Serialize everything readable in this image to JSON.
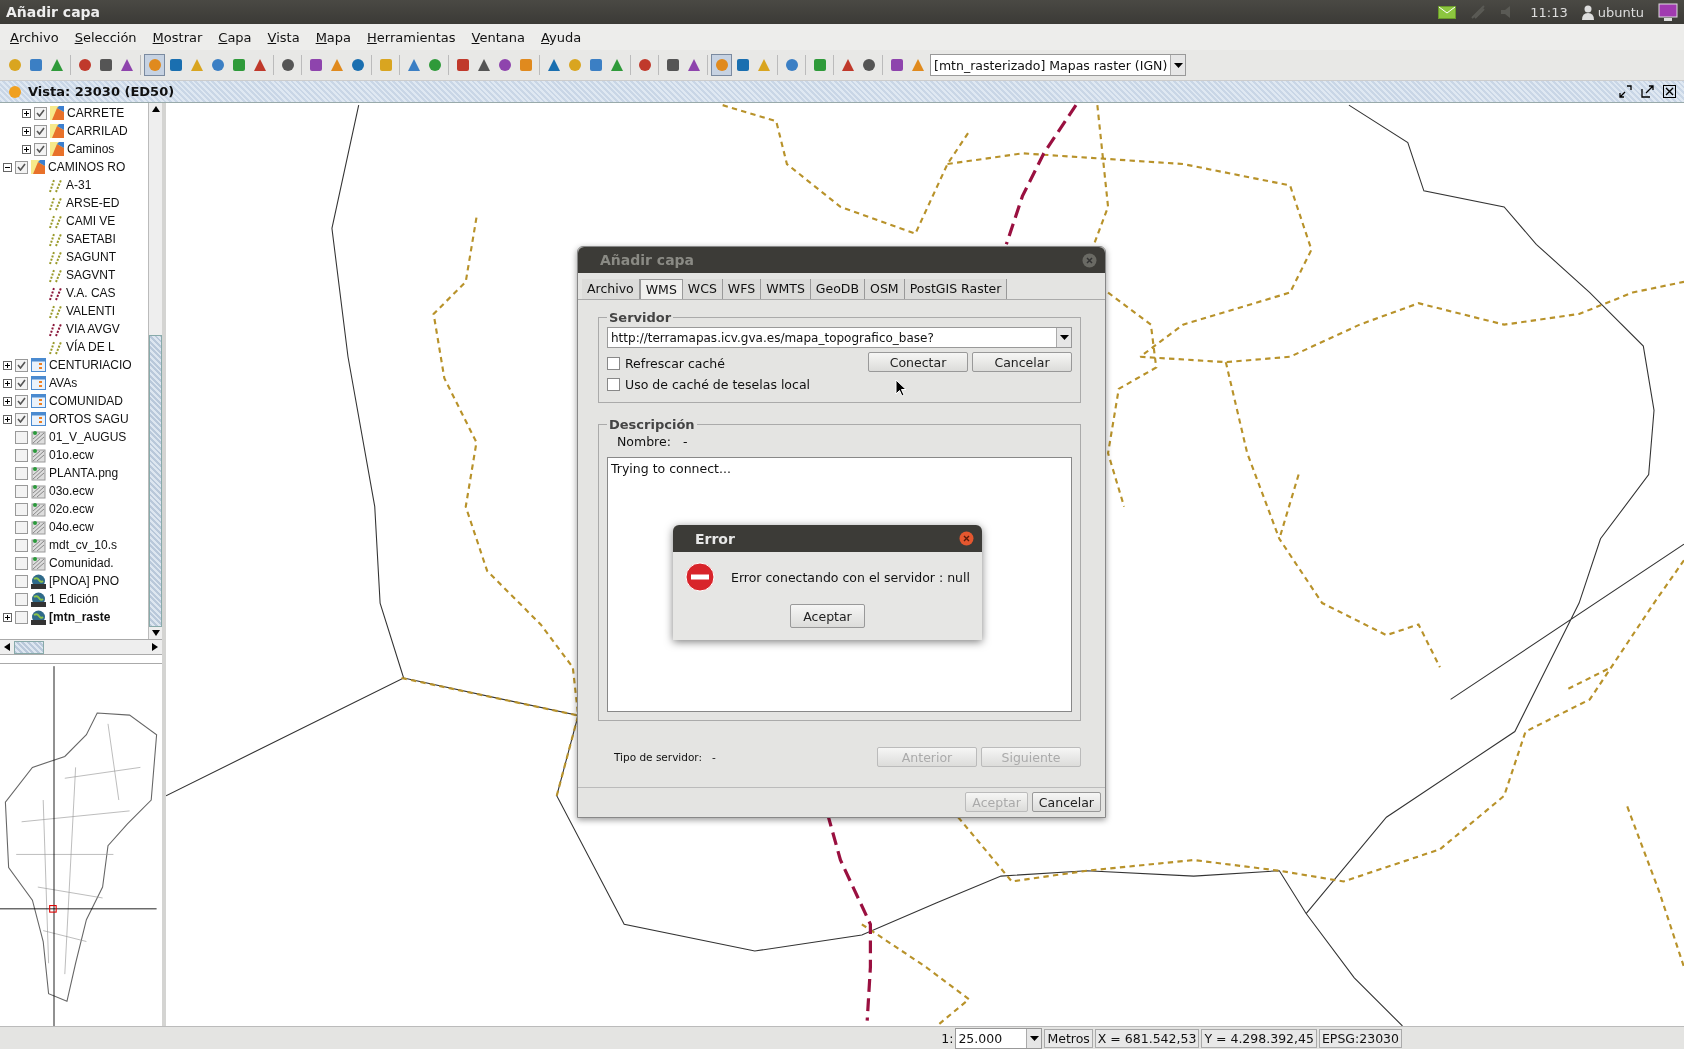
{
  "top_panel": {
    "title": "Añadir capa",
    "clock": "11:13",
    "user": "ubuntu"
  },
  "menu": [
    "Archivo",
    "Selección",
    "Mostrar",
    "Capa",
    "Vista",
    "Mapa",
    "Herramientas",
    "Ventana",
    "Ayuda"
  ],
  "toolbar": {
    "buttons": [
      {
        "selected": false
      },
      {
        "selected": false
      },
      {
        "selected": false
      },
      {
        "selected": false
      },
      {
        "selected": false
      },
      {
        "selected": false
      },
      {
        "selected": true
      },
      {
        "selected": false
      },
      {
        "selected": false
      },
      {
        "selected": false
      },
      {
        "selected": false
      },
      {
        "selected": false
      },
      {
        "selected": false
      },
      {
        "selected": false
      },
      {
        "selected": false
      },
      {
        "selected": false
      },
      {
        "selected": false
      },
      {
        "selected": false
      },
      {
        "selected": false
      },
      {
        "selected": false
      },
      {
        "selected": false
      },
      {
        "selected": false
      },
      {
        "selected": false
      },
      {
        "selected": false
      },
      {
        "selected": false
      },
      {
        "selected": false
      },
      {
        "selected": false
      },
      {
        "selected": false
      },
      {
        "selected": false
      },
      {
        "selected": false
      },
      {
        "selected": true
      },
      {
        "selected": false
      },
      {
        "selected": false
      },
      {
        "selected": false
      },
      {
        "selected": false
      },
      {
        "selected": false
      },
      {
        "selected": false
      },
      {
        "selected": false
      },
      {
        "selected": false
      }
    ],
    "layer_combo": "[mtn_rasterizado] Mapas raster (IGN)"
  },
  "view": {
    "title": "Vista: 23030 (ED50)"
  },
  "tree": {
    "continued_children": [
      {
        "label": "CARRETE",
        "kind": "vector",
        "expanded": false,
        "checked": true,
        "active": false
      },
      {
        "label": "CARRILAD",
        "kind": "vector",
        "expanded": false,
        "checked": true,
        "active": false
      },
      {
        "label": "Caminos",
        "kind": "vector",
        "expanded": false,
        "checked": true,
        "active": false
      }
    ],
    "items": [
      {
        "label": "CAMINOS RO",
        "kind": "vector",
        "expanded": true,
        "checked": true,
        "active": false,
        "children": [
          {
            "label": "A-31",
            "kind": "line"
          },
          {
            "label": "ARSE-ED",
            "kind": "line"
          },
          {
            "label": "CAMI VE",
            "kind": "line"
          },
          {
            "label": "SAETABI",
            "kind": "line"
          },
          {
            "label": "SAGUNT",
            "kind": "line"
          },
          {
            "label": "SAGVNT",
            "kind": "line"
          },
          {
            "label": "V.A. CAS",
            "kind": "line-red"
          },
          {
            "label": "VALENTI",
            "kind": "line"
          },
          {
            "label": "VIA AVGV",
            "kind": "line-red"
          },
          {
            "label": "VÍA DE L",
            "kind": "line"
          }
        ]
      },
      {
        "label": "CENTURIACIO",
        "kind": "group",
        "expanded": false,
        "checked": true,
        "active": false
      },
      {
        "label": "AVAs",
        "kind": "group",
        "expanded": false,
        "checked": true,
        "active": false
      },
      {
        "label": "COMUNIDAD",
        "kind": "group",
        "expanded": false,
        "checked": true,
        "active": false
      },
      {
        "label": "ORTOS SAGU",
        "kind": "group",
        "expanded": false,
        "checked": true,
        "active": false
      },
      {
        "label": "01_V_AUGUS",
        "kind": "raster",
        "checked": false,
        "active": false
      },
      {
        "label": "01o.ecw",
        "kind": "raster",
        "checked": false,
        "active": false
      },
      {
        "label": "PLANTA.png",
        "kind": "raster",
        "checked": false,
        "active": false
      },
      {
        "label": "03o.ecw",
        "kind": "raster",
        "checked": false,
        "active": false
      },
      {
        "label": "02o.ecw",
        "kind": "raster",
        "checked": false,
        "active": false
      },
      {
        "label": "04o.ecw",
        "kind": "raster",
        "checked": false,
        "active": false
      },
      {
        "label": "mdt_cv_10.s",
        "kind": "raster",
        "checked": false,
        "active": false
      },
      {
        "label": "Comunidad.",
        "kind": "raster",
        "checked": false,
        "active": false
      },
      {
        "label": "[PNOA] PNO",
        "kind": "wms",
        "checked": false,
        "active": false
      },
      {
        "label": "1 Edición",
        "kind": "wms",
        "checked": false,
        "active": false
      },
      {
        "label": "[mtn_raste",
        "kind": "wms",
        "expanded": false,
        "checked": false,
        "active": true
      }
    ]
  },
  "dialog": {
    "title": "Añadir capa",
    "tabs": [
      {
        "label": "Archivo",
        "selected": false
      },
      {
        "label": "WMS",
        "selected": true
      },
      {
        "label": "WCS",
        "selected": false
      },
      {
        "label": "WFS",
        "selected": false
      },
      {
        "label": "WMTS",
        "selected": false
      },
      {
        "label": "GeoDB",
        "selected": false
      },
      {
        "label": "OSM",
        "selected": false
      },
      {
        "label": "PostGIS Raster",
        "selected": false
      }
    ],
    "server": {
      "legend": "Servidor",
      "url": "http://terramapas.icv.gva.es/mapa_topografico_base?",
      "connect": "Conectar",
      "cancel": "Cancelar",
      "options": [
        {
          "label": "Refrescar caché",
          "checked": false
        },
        {
          "label": "Uso de caché de teselas local",
          "checked": false
        }
      ]
    },
    "description": {
      "legend": "Descripción",
      "name_label": "Nombre:",
      "name_value": "-",
      "log": "Trying to connect..."
    },
    "server_type_label": "Tipo de servidor:",
    "server_type_value": "-",
    "nav_buttons": [
      {
        "label": "Anterior",
        "disabled": true
      },
      {
        "label": "Siguiente",
        "disabled": true
      }
    ],
    "footer_buttons": [
      {
        "label": "Aceptar",
        "disabled": true
      },
      {
        "label": "Cancelar",
        "disabled": false
      }
    ]
  },
  "error": {
    "title": "Error",
    "message": "Error conectando con el servidor : null",
    "button": "Aceptar"
  },
  "status_bar": {
    "scale_prefix": "1:",
    "scale": "25.000",
    "units": "Metros",
    "x": "X = 681.542,53",
    "y": "Y = 4.298.392,45",
    "crs": "EPSG:23030"
  }
}
